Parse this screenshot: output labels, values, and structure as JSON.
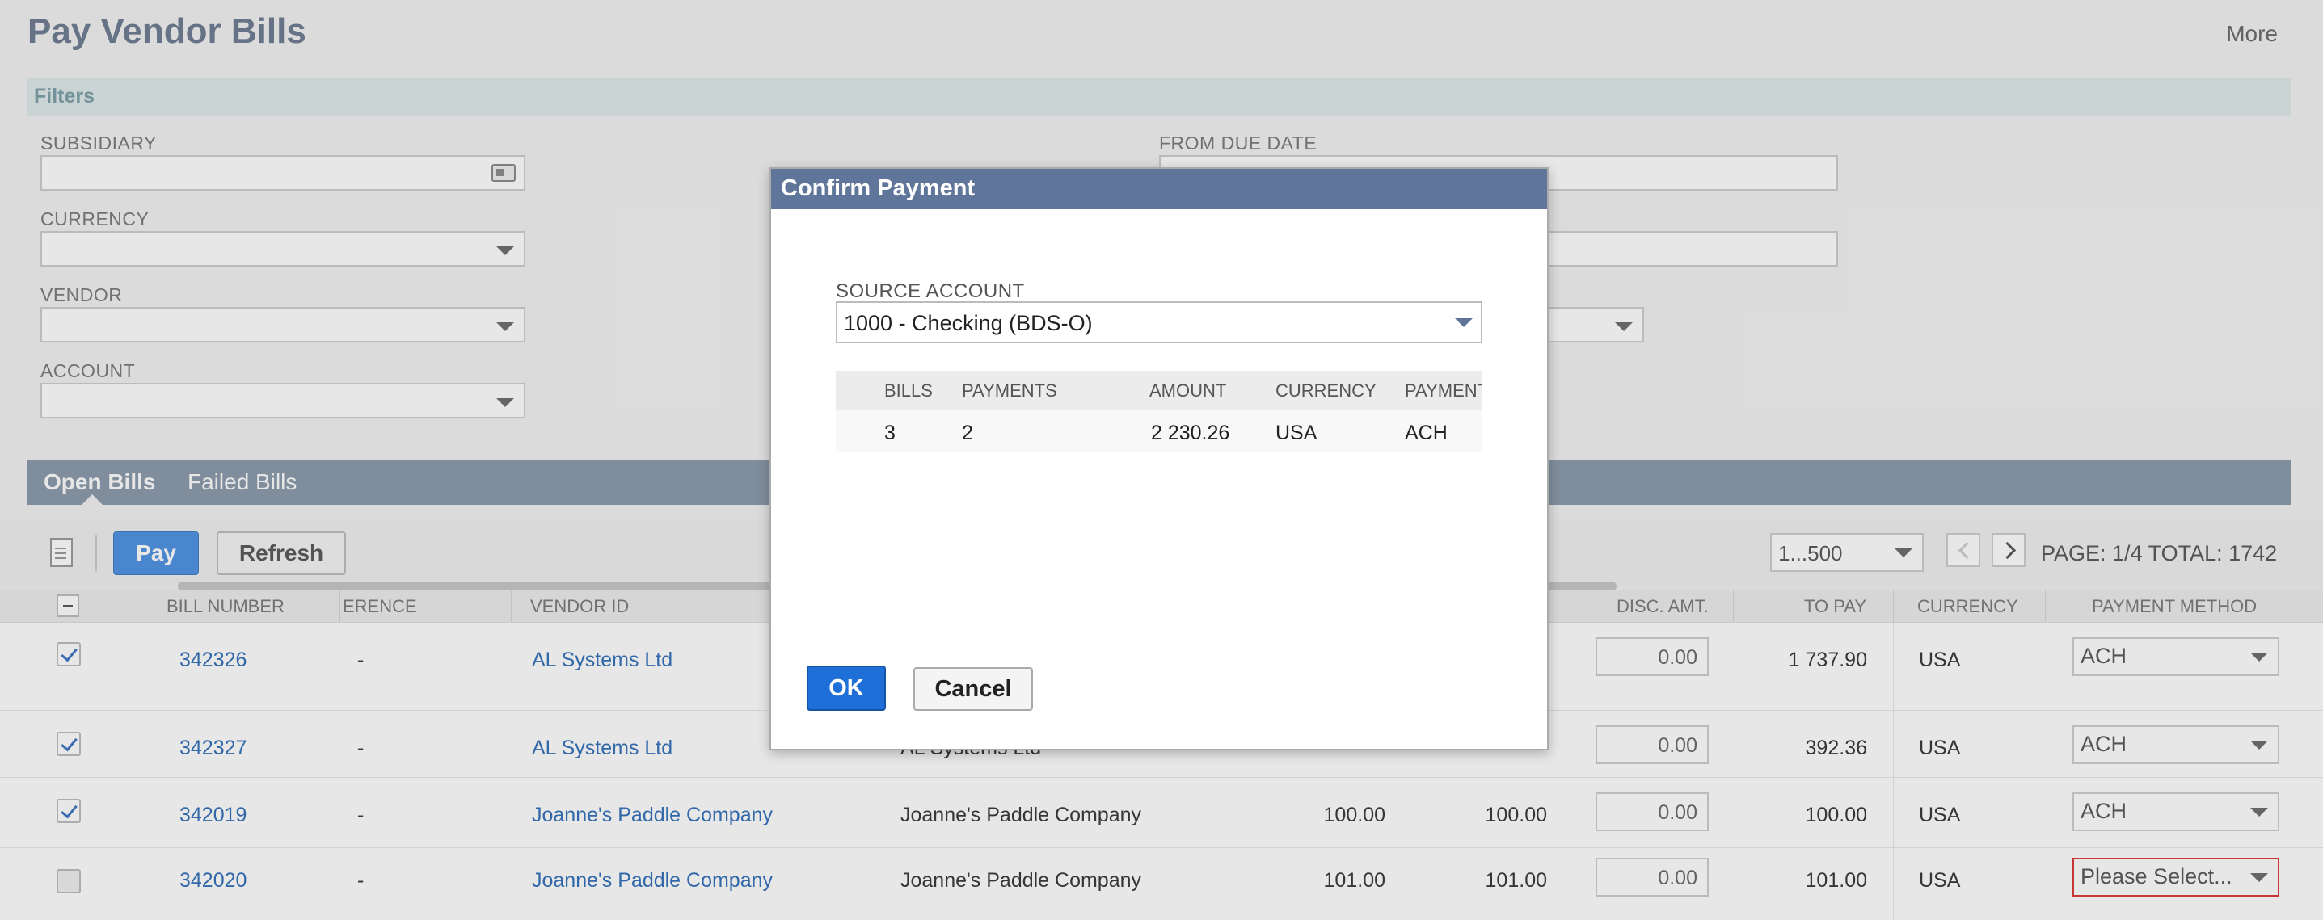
{
  "page": {
    "title": "Pay Vendor Bills",
    "more_label": "More"
  },
  "filters": {
    "section_label": "Filters",
    "subsidiary_label": "SUBSIDIARY",
    "currency_label": "CURRENCY",
    "vendor_label": "VENDOR",
    "account_label": "ACCOUNT",
    "from_due_date_label": "FROM DUE DATE"
  },
  "tabs": [
    {
      "label": "Open Bills"
    },
    {
      "label": "Failed Bills"
    }
  ],
  "toolbar": {
    "pay_label": "Pay",
    "refresh_label": "Refresh",
    "range_value": "1...500",
    "page_info": "PAGE: 1/4",
    "total_info": "TOTAL: 1742"
  },
  "table": {
    "columns": {
      "bill_number": "BILL NUMBER",
      "reference": "ERENCE",
      "vendor_id": "VENDOR ID",
      "disc_amt": "DISC. AMT.",
      "to_pay": "TO PAY",
      "currency": "CURRENCY",
      "payment_method": "PAYMENT METHOD"
    },
    "rows": [
      {
        "checked": true,
        "bill_number": "342326",
        "reference": "-",
        "vendor_id": "AL Systems Ltd",
        "vendor_name": "",
        "amount": "",
        "amount_due": "",
        "disc_amt": "0.00",
        "to_pay": "1 737.90",
        "currency": "USA",
        "payment_method": "ACH"
      },
      {
        "checked": true,
        "bill_number": "342327",
        "reference": "-",
        "vendor_id": "AL Systems Ltd",
        "vendor_name": "AL Systems Ltd",
        "amount": "",
        "amount_due": "",
        "disc_amt": "0.00",
        "to_pay": "392.36",
        "currency": "USA",
        "payment_method": "ACH"
      },
      {
        "checked": true,
        "bill_number": "342019",
        "reference": "-",
        "vendor_id": "Joanne's Paddle Company",
        "vendor_name": "Joanne's Paddle Company",
        "amount": "100.00",
        "amount_due": "100.00",
        "disc_amt": "0.00",
        "to_pay": "100.00",
        "currency": "USA",
        "payment_method": "ACH"
      },
      {
        "checked": false,
        "bill_number": "342020",
        "reference": "-",
        "vendor_id": "Joanne's Paddle Company",
        "vendor_name": "Joanne's Paddle Company",
        "amount": "101.00",
        "amount_due": "101.00",
        "disc_amt": "0.00",
        "to_pay": "101.00",
        "currency": "USA",
        "payment_method": "Please Select..."
      }
    ]
  },
  "modal": {
    "title": "Confirm Payment",
    "source_account_label": "SOURCE ACCOUNT",
    "source_account_value": "1000 - Checking (BDS-O)",
    "summary_headers": {
      "bills": "BILLS",
      "payments": "PAYMENTS",
      "amount": "AMOUNT",
      "currency": "CURRENCY",
      "payment": "PAYMENT"
    },
    "summary_row": {
      "bills": "3",
      "payments": "2",
      "amount": "2 230.26",
      "currency": "USA",
      "payment": "ACH"
    },
    "ok_label": "OK",
    "cancel_label": "Cancel"
  },
  "colors": {
    "header_blue": "#5f7599",
    "primary_button": "#1f6fd8",
    "link": "#2e6db8",
    "tab_bar": "#8a98a9"
  }
}
